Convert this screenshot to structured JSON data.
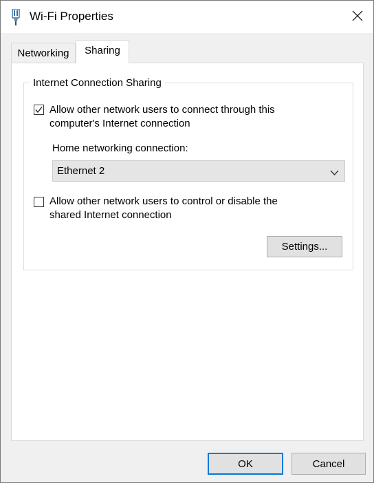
{
  "window": {
    "title": "Wi-Fi Properties",
    "icons": {
      "app": "network-adapter-icon",
      "close": "close-icon"
    }
  },
  "tabs": [
    {
      "label": "Networking",
      "active": false
    },
    {
      "label": "Sharing",
      "active": true
    }
  ],
  "sharing": {
    "group_label": "Internet Connection Sharing",
    "allow_connect": {
      "checked": true,
      "line1": "Allow other network users to connect through this",
      "line2": "computer's Internet connection"
    },
    "home_connection": {
      "label": "Home networking connection:",
      "selected": "Ethernet 2"
    },
    "allow_control": {
      "checked": false,
      "line1": "Allow other network users to control or disable the",
      "line2": "shared Internet connection"
    },
    "settings_button": "Settings..."
  },
  "footer": {
    "ok_label": "OK",
    "cancel_label": "Cancel"
  },
  "colors": {
    "accent": "#0078d7",
    "button_bg": "#e1e1e1",
    "panel_bg": "#ffffff",
    "window_bg": "#f0f0f0"
  }
}
